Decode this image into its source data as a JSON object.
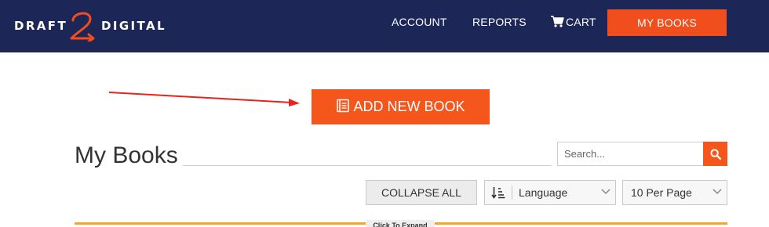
{
  "header": {
    "logo": {
      "left_word": "DRAFT",
      "right_word": "DIGITAL",
      "mark_digit": "2"
    },
    "nav": [
      {
        "label": "ACCOUNT"
      },
      {
        "label": "REPORTS"
      },
      {
        "label": "CART",
        "icon": "cart-icon"
      }
    ],
    "active_button": "MY BOOKS"
  },
  "actions": {
    "add_book_label": "ADD NEW BOOK",
    "add_book_icon": "book-icon"
  },
  "main": {
    "title": "My Books",
    "search": {
      "placeholder": "Search...",
      "value": "",
      "icon": "search-icon"
    },
    "collapse_label": "COLLAPSE ALL",
    "sort": {
      "icon": "sort-icon",
      "selected": "Language"
    },
    "per_page": {
      "selected": "10 Per Page"
    },
    "expand_label": "Click To Expand"
  },
  "colors": {
    "header_bg": "#1d2757",
    "accent": "#f4561c",
    "annotation": "#e8221c",
    "expand_line": "#f6a623"
  }
}
